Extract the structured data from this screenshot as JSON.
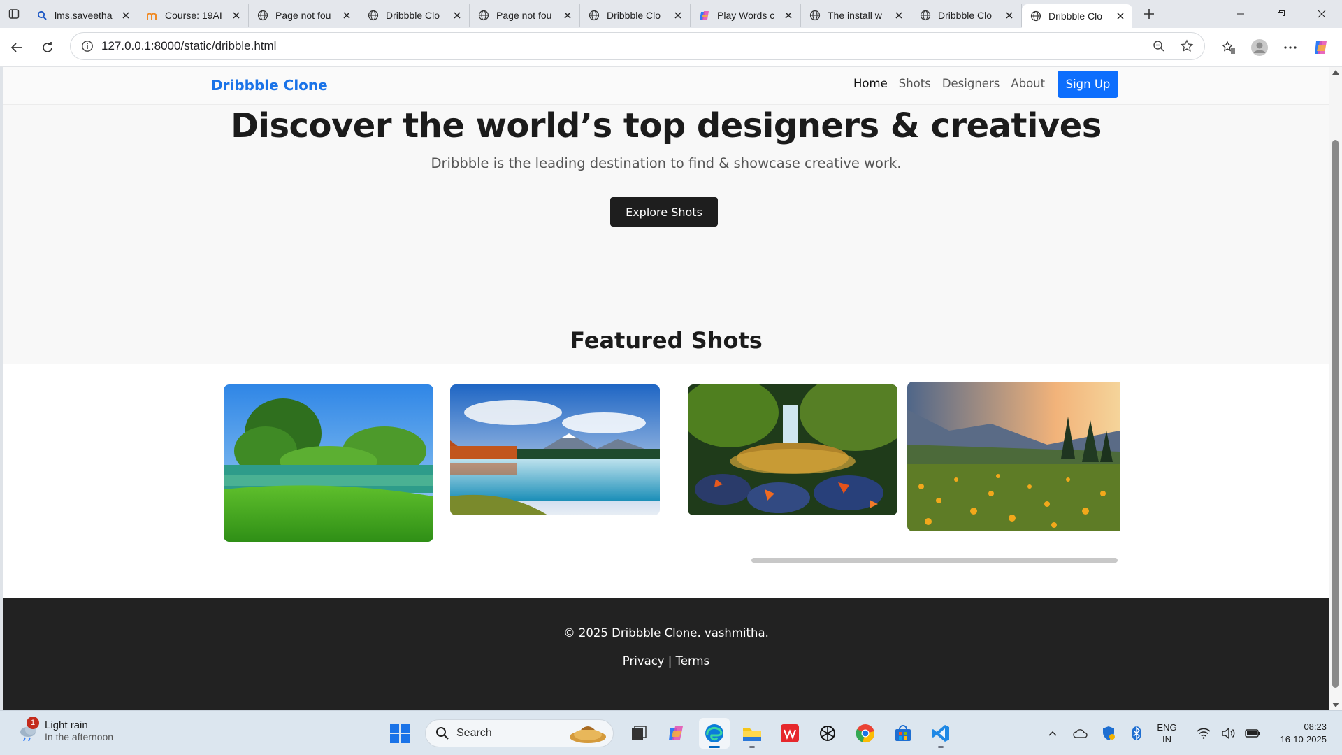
{
  "browser": {
    "tabs": [
      {
        "title": "lms.saveetha",
        "icon": "search-icon"
      },
      {
        "title": "Course: 19AI",
        "icon": "moodle-icon"
      },
      {
        "title": "Page not fou",
        "icon": "globe-icon"
      },
      {
        "title": "Dribbble Clo",
        "icon": "globe-icon"
      },
      {
        "title": "Page not fou",
        "icon": "globe-icon"
      },
      {
        "title": "Dribbble Clo",
        "icon": "globe-icon"
      },
      {
        "title": "Play Words c",
        "icon": "copilot-icon"
      },
      {
        "title": "The install w",
        "icon": "globe-icon"
      },
      {
        "title": "Dribbble Clo",
        "icon": "globe-icon"
      },
      {
        "title": "Dribbble Clo",
        "icon": "globe-icon"
      }
    ],
    "active_tab_index": 9,
    "url": "127.0.0.1:8000/static/dribble.html"
  },
  "site": {
    "logo": "Dribbble Clone",
    "nav": [
      {
        "label": "Home"
      },
      {
        "label": "Shots"
      },
      {
        "label": "Designers"
      },
      {
        "label": "About"
      }
    ],
    "signup_label": "Sign Up",
    "hero_title": "Discover the world’s top designers & creatives",
    "hero_subtitle": "Dribbble is the leading destination to find & showcase creative work.",
    "explore_label": "Explore Shots",
    "featured_title": "Featured Shots",
    "shots": [
      {
        "subject": "green lake with trees"
      },
      {
        "subject": "mountain lake reflection"
      },
      {
        "subject": "waterfall with autumn leaves"
      },
      {
        "subject": "meadow at sunset"
      }
    ],
    "footer_copy": "© 2025 Dribbble Clone. vashmitha.",
    "footer_privacy": "Privacy",
    "footer_sep": " | ",
    "footer_terms": "Terms"
  },
  "taskbar": {
    "weather_badge": "1",
    "weather_title": "Light rain",
    "weather_sub": "In the afternoon",
    "search_label": "Search",
    "lang_top": "ENG",
    "lang_bottom": "IN",
    "time": "08:23",
    "date": "16-10-2025"
  },
  "colors": {
    "brand_blue": "#1a73e8",
    "signup_bg": "#0d6efd",
    "explore_bg": "#1e1e1e",
    "footer_bg": "#222222"
  }
}
